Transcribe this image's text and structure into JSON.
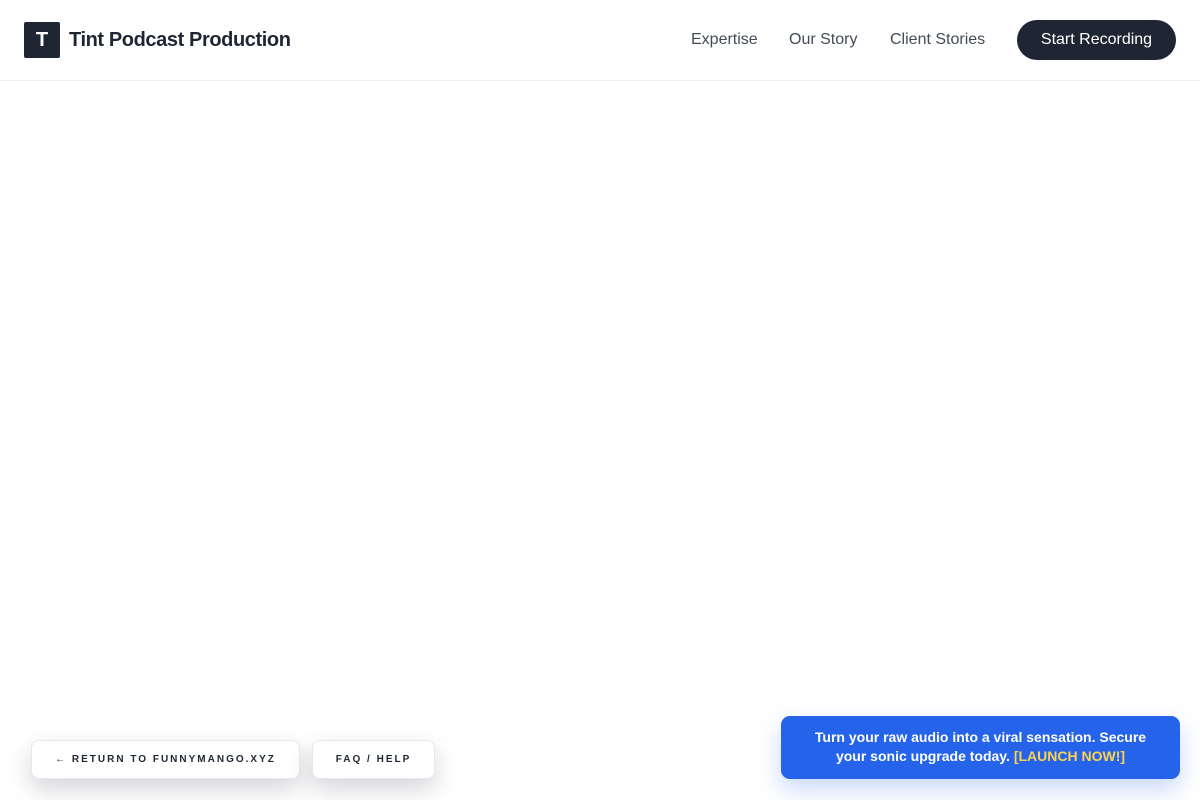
{
  "header": {
    "logo_letter": "T",
    "brand_name": "Tint Podcast Production",
    "nav": [
      {
        "label": "Expertise"
      },
      {
        "label": "Our Story"
      },
      {
        "label": "Client Stories"
      }
    ],
    "cta_label": "Start Recording"
  },
  "footer_links": {
    "return_label": "← RETURN TO FUNNYMANGO.XYZ",
    "faq_label": "FAQ / HELP"
  },
  "promo": {
    "text": "Turn your raw audio into a viral sensation. Secure your sonic upgrade today. ",
    "link_label": "[LAUNCH NOW!]"
  },
  "colors": {
    "primary_dark": "#1e2633",
    "promo_blue": "#2563eb",
    "promo_link": "#fcd34d"
  }
}
